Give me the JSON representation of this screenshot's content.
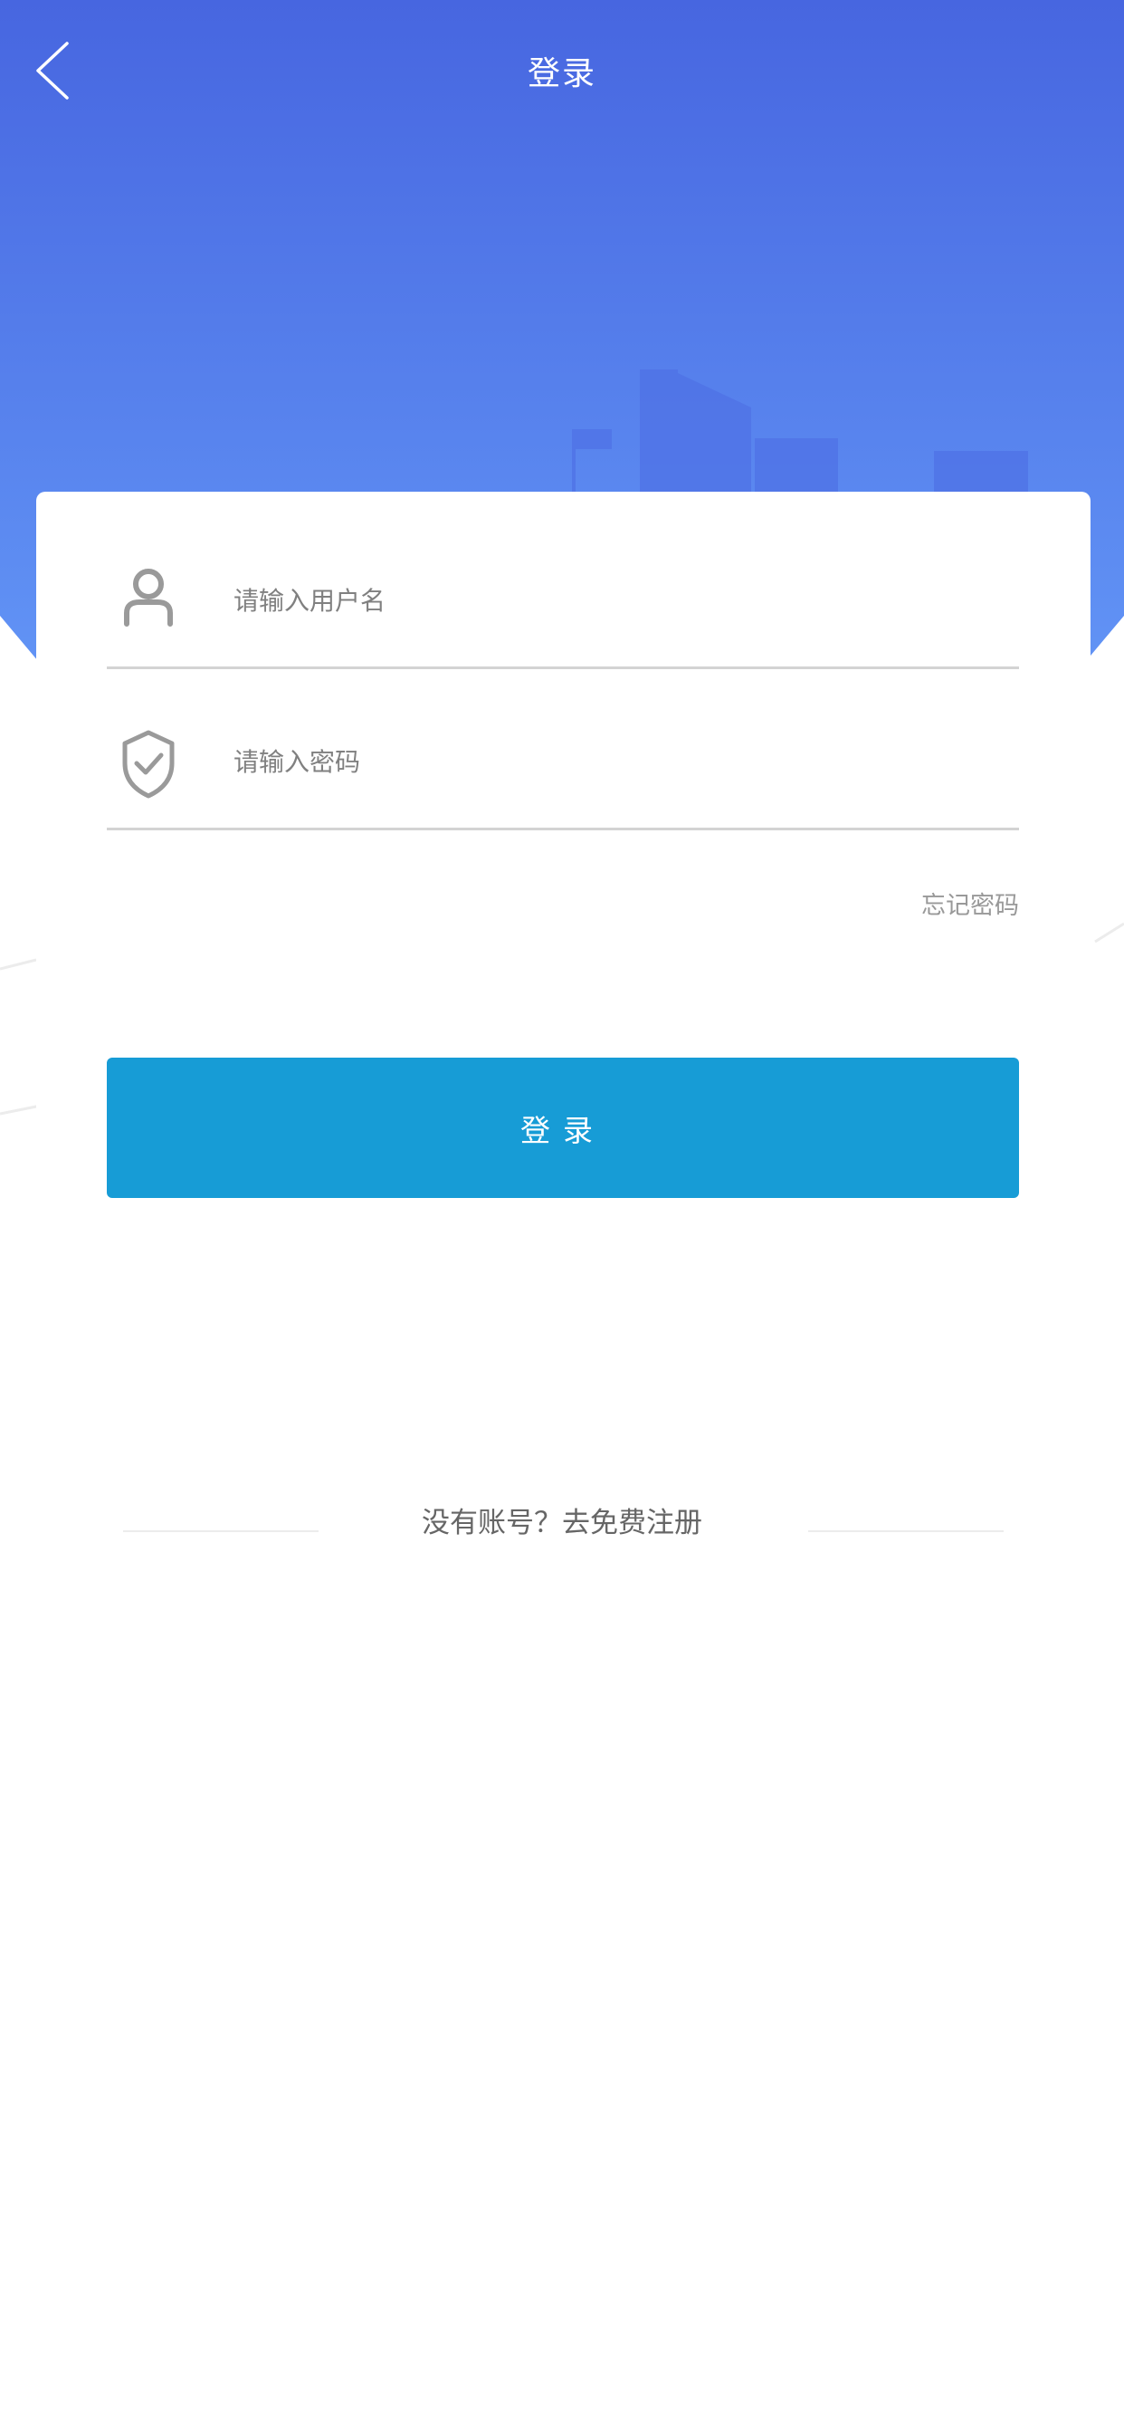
{
  "header": {
    "title": "登录",
    "back_icon": "chevron-left-icon"
  },
  "form": {
    "username": {
      "icon": "user-icon",
      "placeholder": "请输入用户名",
      "value": ""
    },
    "password": {
      "icon": "shield-check-icon",
      "placeholder": "请输入密码",
      "value": ""
    },
    "forgot_label": "忘记密码",
    "submit_label": "登录"
  },
  "footer": {
    "register_text": "没有账号？去免费注册"
  },
  "colors": {
    "header_gradient_top": "#4766e0",
    "header_gradient_bottom": "#6193f5",
    "button": "#179cd6",
    "title_text": "#ffffff"
  }
}
